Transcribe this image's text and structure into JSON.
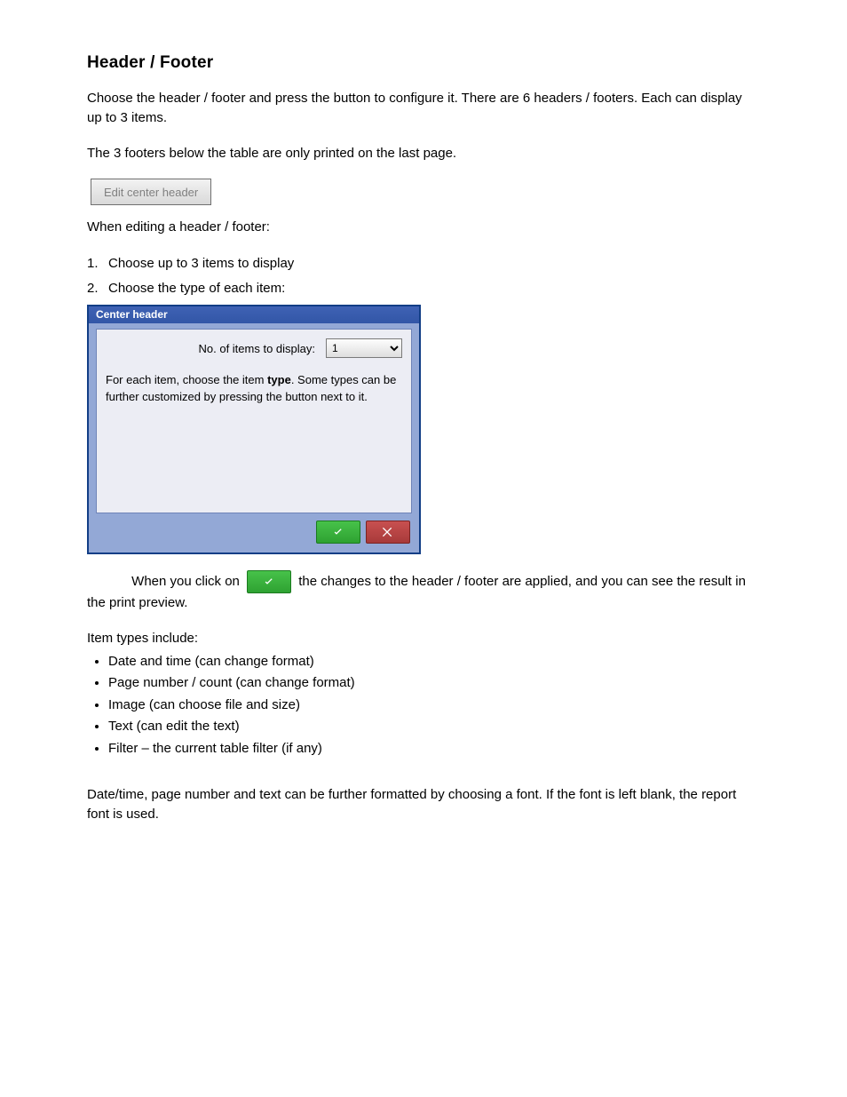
{
  "section": {
    "title": "Header / Footer",
    "intro_1": "Choose the header / footer and press the button to configure it. There are 6 headers / footers.  Each can display up to 3 items.",
    "intro_2": "The 3 footers below the table are only printed on the last page."
  },
  "edit_button": {
    "label": "Edit center header"
  },
  "edit_instruction": "When editing a header / footer:",
  "steps": {
    "s1_num": "1.",
    "s1_text": "Choose up to 3 items to display",
    "s2_num": "2.",
    "s2_text": "Choose the type of each item:"
  },
  "dialog": {
    "title": "Center header",
    "label": "No. of items to display:",
    "select_value": "1",
    "explain_prefix": "For each item, choose the item ",
    "explain_bold": "type",
    "explain_suffix": ".  Some types can be further customized by pressing the button next to it.",
    "ok_aria": "OK",
    "cancel_aria": "Cancel"
  },
  "confirm_text_before": "When you click on ",
  "confirm_text_after": " the changes to the header / footer are applied, and you can see the result in the print preview.",
  "types_intro": "Item types include:",
  "types": [
    "Date and time (can change format)",
    "Page number / count (can change format)",
    "Image (can choose file and size)",
    "Text (can edit the text)",
    "Filter – the current table filter (if any)"
  ],
  "final_para": "Date/time, page number and text can be further formatted by choosing a font.  If the font is left blank, the report font is used."
}
